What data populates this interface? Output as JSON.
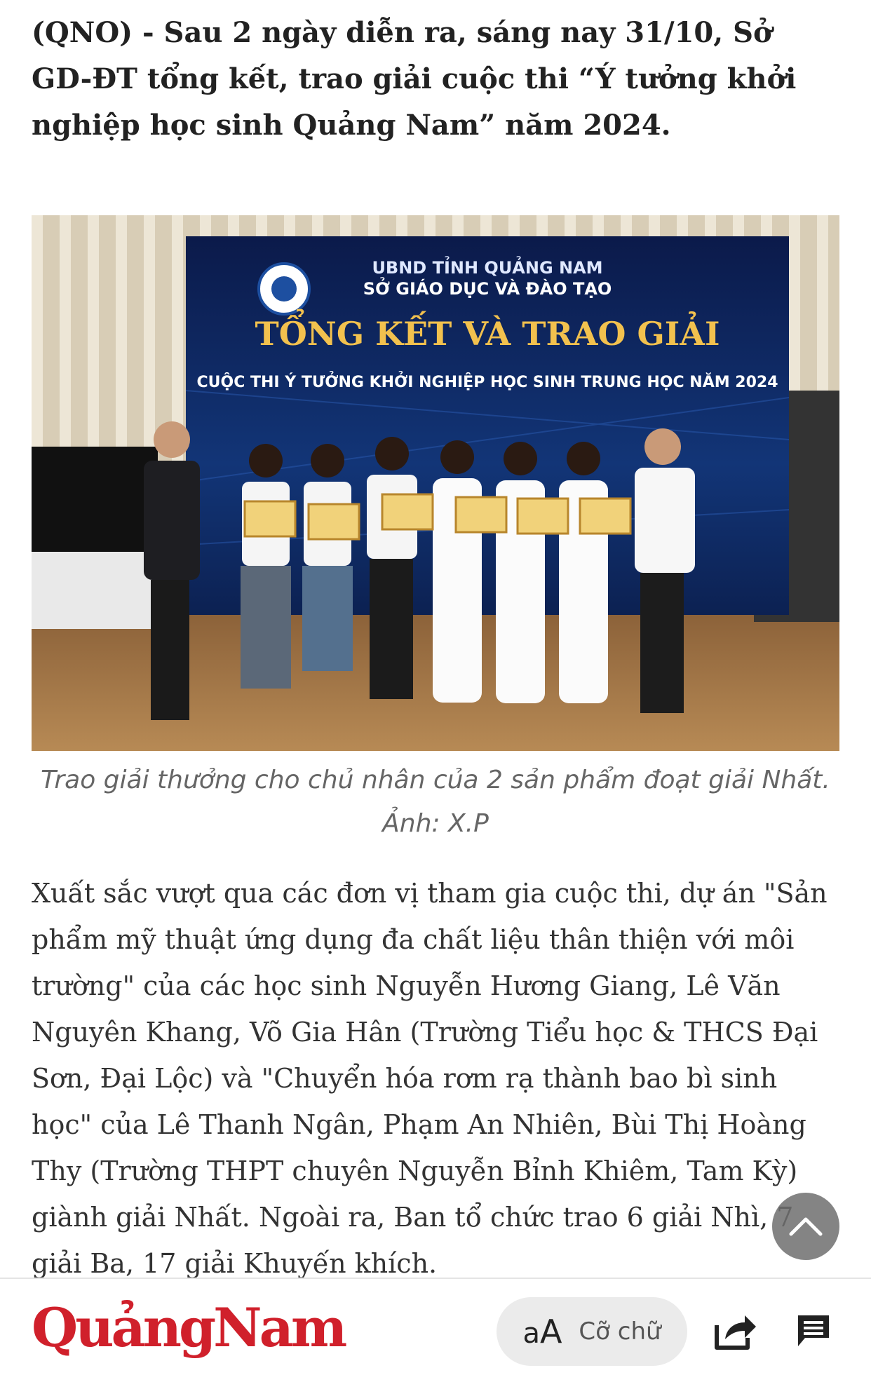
{
  "article": {
    "lead": "(QNO) - Sau 2 ngày diễn ra, sáng nay 31/10, Sở GD-ĐT tổng kết, trao giải cuộc thi “Ý tưởng khởi nghiệp học sinh Quảng Nam” năm 2024.",
    "photo": {
      "banner_line1": "UBND TỈNH QUẢNG NAM",
      "banner_line2": "SỞ GIÁO DỤC VÀ ĐÀO TẠO",
      "banner_title": "TỔNG KẾT VÀ TRAO GIẢI",
      "banner_subtitle": "CUỘC THI Ý TƯỞNG KHỞI NGHIỆP HỌC SINH TRUNG HỌC NĂM 2024"
    },
    "caption_line1": "Trao giải thưởng cho chủ nhân của 2 sản phẩm đoạt giải Nhất.",
    "caption_line2": "Ảnh: X.P",
    "body": "Xuất sắc vượt qua các đơn vị tham gia cuộc thi, dự án \"Sản phẩm mỹ thuật ứng dụng đa chất liệu thân thiện với môi trường\" của các học sinh Nguyễn Hương Giang, Lê Văn Nguyên Khang, Võ Gia Hân (Trường Tiểu học & THCS Đại Sơn, Đại Lộc) và \"Chuyển hóa rơm rạ thành bao bì sinh học\" của Lê Thanh Ngân, Phạm An Nhiên, Bùi Thị Hoàng Thy (Trường THPT chuyên Nguyễn Bỉnh Khiêm, Tam Kỳ) giành giải Nhất. Ngoài ra, Ban tổ chức trao 6 giải Nhì, 7 giải Ba, 17 giải Khuyến khích."
  },
  "toolbar": {
    "logo": "QuảngNam",
    "font_size_icon": "aA",
    "font_size_icon_small": "a",
    "font_size_icon_big": "A",
    "font_size_label": "Cỡ chữ",
    "share_icon": "share-icon",
    "comment_icon": "comment-icon",
    "brand_color": "#d0202b"
  },
  "scroll_top_icon": "chevron-up-icon"
}
